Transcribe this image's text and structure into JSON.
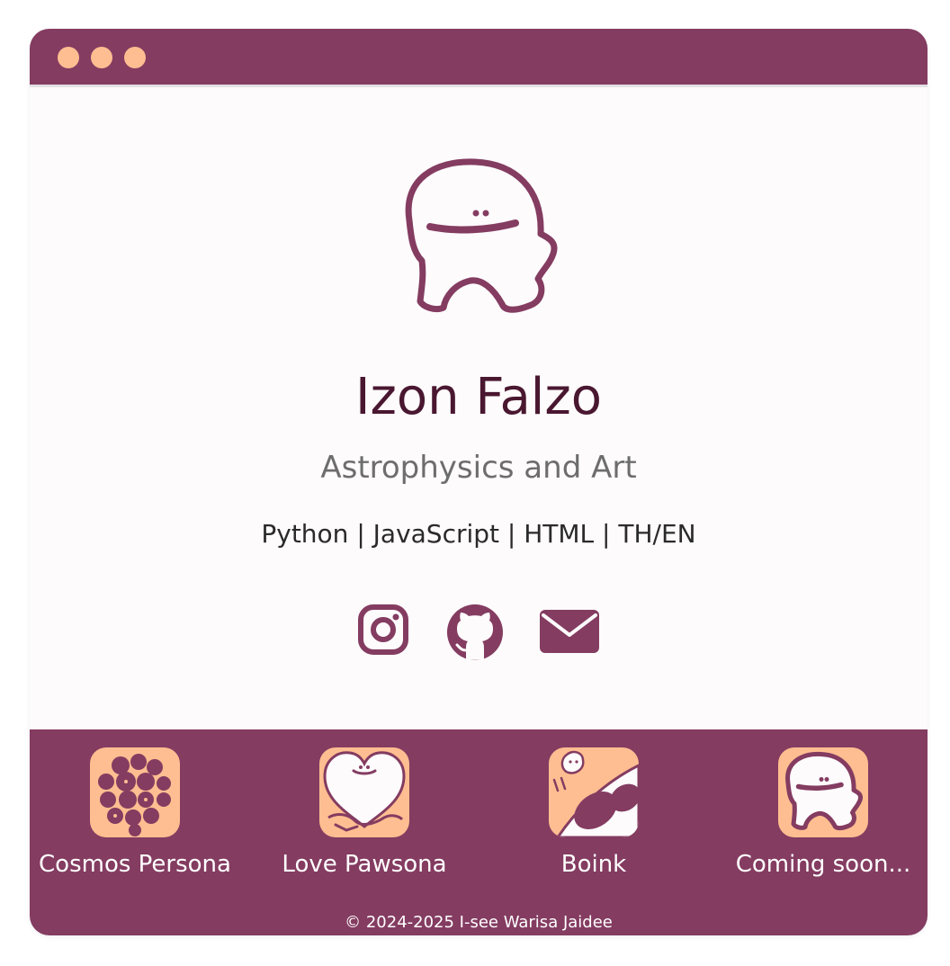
{
  "colors": {
    "brand": "#843c61",
    "dots": "#ffbe91",
    "name_text": "#4a1730",
    "subtitle_text": "#6d6d6d",
    "footer_text": "#ffffff"
  },
  "titlebar": {
    "dots": [
      "window-dot-1",
      "window-dot-2",
      "window-dot-3"
    ]
  },
  "profile": {
    "avatar_icon": "mascot-icon",
    "name": "Izon Falzo",
    "subtitle": "Astrophysics and Art",
    "skills": "Python | JavaScript | HTML | TH/EN"
  },
  "social": {
    "links": [
      {
        "icon": "instagram-icon"
      },
      {
        "icon": "github-icon"
      },
      {
        "icon": "email-icon"
      }
    ]
  },
  "projects": [
    {
      "label": "Cosmos Persona",
      "icon": "cosmos-persona-icon"
    },
    {
      "label": "Love Pawsona",
      "icon": "love-pawsona-icon"
    },
    {
      "label": "Boink",
      "icon": "boink-icon"
    },
    {
      "label": "Coming soon...",
      "icon": "coming-soon-icon"
    }
  ],
  "footer": {
    "copyright": "© 2024-2025 I-see Warisa Jaidee"
  }
}
